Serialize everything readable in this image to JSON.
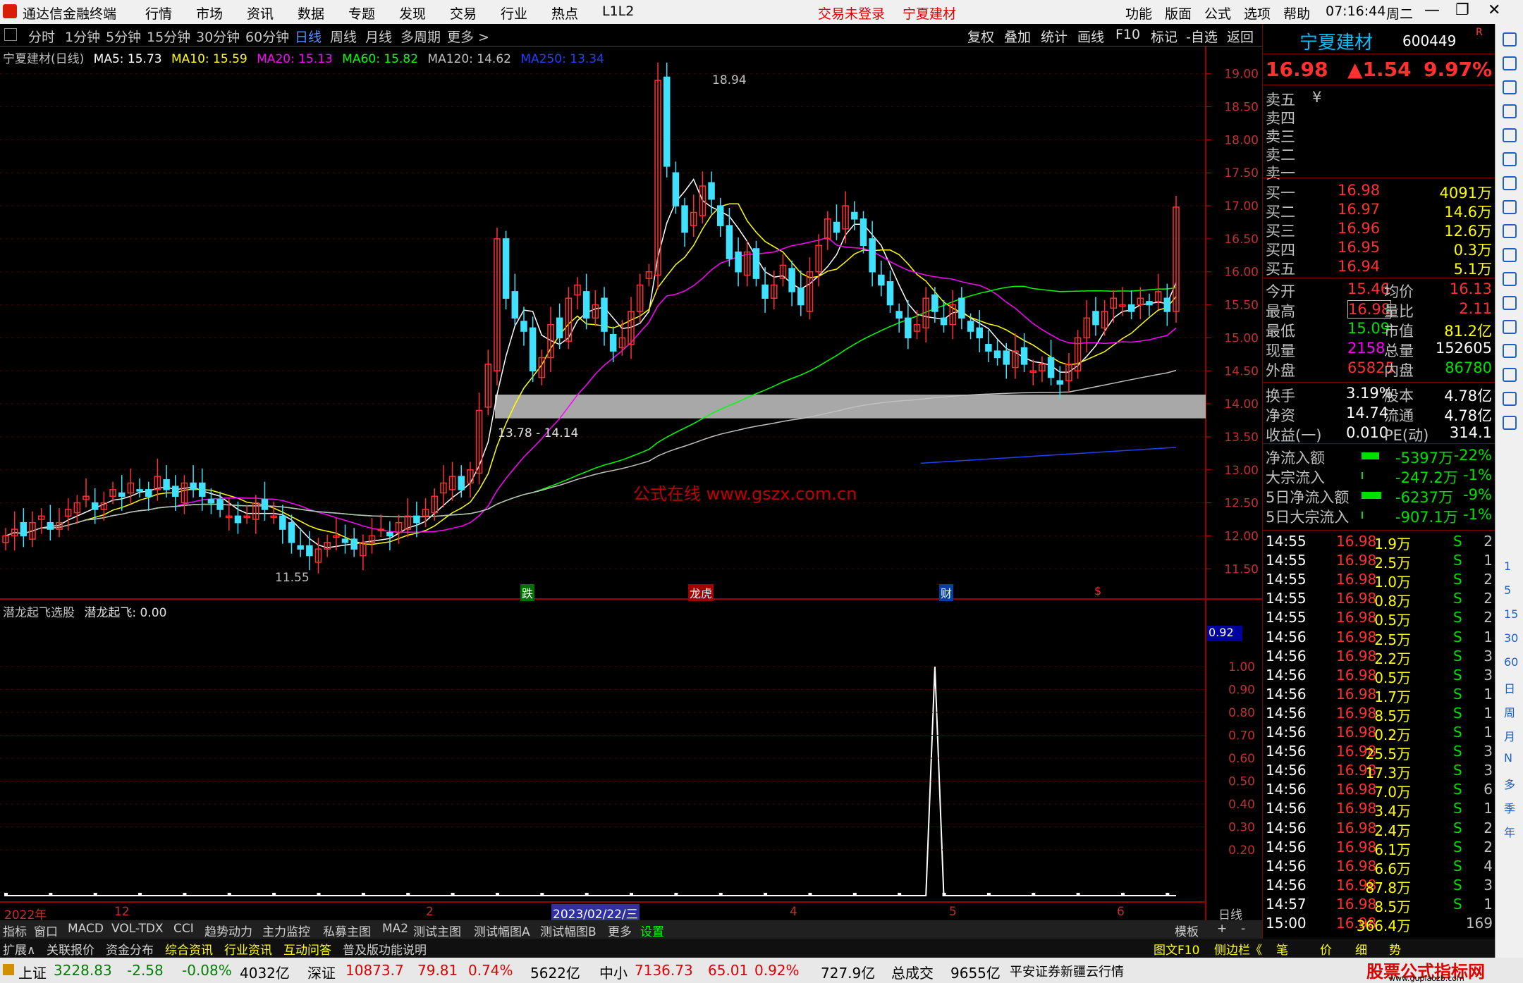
{
  "menubar": {
    "app_title": "通达信金融终端",
    "items": [
      "行情",
      "市场",
      "资讯",
      "数据",
      "专题",
      "发现",
      "交易",
      "行业",
      "热点",
      "L1L2"
    ],
    "login_status": "交易未登录",
    "stock_title": "宁夏建材",
    "right_items": [
      "功能",
      "版面",
      "公式",
      "选项",
      "帮助"
    ],
    "time": "07:16:44",
    "weekday": "周二"
  },
  "periodbar": {
    "periods": [
      "分时",
      "1分钟",
      "5分钟",
      "15分钟",
      "30分钟",
      "60分钟",
      "日线",
      "周线",
      "月线",
      "多周期",
      "更多 >"
    ],
    "active": "日线",
    "tools": [
      "复权",
      "叠加",
      "统计",
      "画线",
      "F10",
      "标记",
      "-自选",
      "返回"
    ]
  },
  "main_legend": {
    "title": "宁夏建材(日线)",
    "mas": [
      {
        "text": "MA5: 15.73",
        "color": "#ffffff"
      },
      {
        "text": "MA10: 15.59",
        "color": "#ffff00"
      },
      {
        "text": "MA20: 15.13",
        "color": "#ff00ff"
      },
      {
        "text": "MA60: 15.82",
        "color": "#00ff00"
      },
      {
        "text": "MA120: 14.62",
        "color": "#c0c0c0"
      },
      {
        "text": "MA250: 13.34",
        "color": "#2040ff"
      }
    ]
  },
  "price_axis": [
    "19.00",
    "18.50",
    "18.00",
    "17.50",
    "17.00",
    "16.50",
    "16.00",
    "15.50",
    "15.00",
    "14.50",
    "14.00",
    "13.50",
    "13.00",
    "12.50",
    "12.00",
    "11.50"
  ],
  "annotations": {
    "high_label": "18.94",
    "low_label": "11.55",
    "band_label": "13.78 - 14.14",
    "watermark": "公式在线  www.gszx.com.cn",
    "event_markers": [
      "跌",
      "龙虎",
      "财",
      "$"
    ]
  },
  "sub_legend": {
    "title": "潜龙起飞选股",
    "value_text": "潜龙起飞: 0.00"
  },
  "sub_axis": [
    "1.00",
    "0.90",
    "0.80",
    "0.70",
    "0.60",
    "0.50",
    "0.40",
    "0.30",
    "0.20"
  ],
  "sub_value_box": "0.92",
  "date_axis": {
    "labels": [
      "2022年",
      "12",
      "2",
      "2023/02/22/三",
      "4",
      "5",
      "6"
    ],
    "period_label": "日线"
  },
  "quote": {
    "name": "宁夏建材",
    "code": "600449",
    "price": "16.98",
    "change": "▲1.54",
    "pct": "9.97%",
    "asks": [
      {
        "label": "卖五",
        "price": "¥",
        "vol": ""
      },
      {
        "label": "卖四",
        "price": "",
        "vol": ""
      },
      {
        "label": "卖三",
        "price": "",
        "vol": ""
      },
      {
        "label": "卖二",
        "price": "",
        "vol": ""
      },
      {
        "label": "卖一",
        "price": "",
        "vol": ""
      }
    ],
    "bids": [
      {
        "label": "买一",
        "price": "16.98",
        "vol": "4091万"
      },
      {
        "label": "买二",
        "price": "16.97",
        "vol": "14.6万"
      },
      {
        "label": "买三",
        "price": "16.96",
        "vol": "12.6万"
      },
      {
        "label": "买四",
        "price": "16.95",
        "vol": "0.3万"
      },
      {
        "label": "买五",
        "price": "16.94",
        "vol": "5.1万"
      }
    ],
    "stats1": [
      {
        "l1": "今开",
        "v1": "15.46",
        "l2": "均价",
        "v2": "16.13"
      },
      {
        "l1": "最高",
        "v1": "16.98",
        "l2": "量比",
        "v2": "2.11"
      },
      {
        "l1": "最低",
        "v1": "15.09",
        "l2": "市值",
        "v2": "81.2亿"
      },
      {
        "l1": "现量",
        "v1": "2158",
        "l2": "总量",
        "v2": "152605"
      },
      {
        "l1": "外盘",
        "v1": "65825",
        "l2": "内盘",
        "v2": "86780"
      }
    ],
    "stats2": [
      {
        "l1": "换手",
        "v1": "3.19%",
        "l2": "股本",
        "v2": "4.78亿"
      },
      {
        "l1": "净资",
        "v1": "14.74",
        "l2": "流通",
        "v2": "4.78亿"
      },
      {
        "l1": "收益(一)",
        "v1": "0.010",
        "l2": "PE(动)",
        "v2": "314.1"
      }
    ],
    "flows": [
      {
        "label": "净流入额",
        "value": "-5397万",
        "pct": "-22%",
        "bar": 0.9
      },
      {
        "label": "大宗流入",
        "value": "-247.2万",
        "pct": "-1%",
        "bar": 0.05
      },
      {
        "label": "5日净流入额",
        "value": "-6237万",
        "pct": "-9%",
        "bar": 1.0
      },
      {
        "label": "5日大宗流入",
        "value": "-907.1万",
        "pct": "-1%",
        "bar": 0.05
      }
    ],
    "ticks": [
      {
        "t": "14:55",
        "p": "16.98",
        "v": "1.9万",
        "s": "S",
        "n": "2"
      },
      {
        "t": "14:55",
        "p": "16.98",
        "v": "2.5万",
        "s": "S",
        "n": "1"
      },
      {
        "t": "14:55",
        "p": "16.98",
        "v": "1.0万",
        "s": "S",
        "n": "2"
      },
      {
        "t": "14:55",
        "p": "16.98",
        "v": "0.8万",
        "s": "S",
        "n": "2"
      },
      {
        "t": "14:55",
        "p": "16.98",
        "v": "0.5万",
        "s": "S",
        "n": "2"
      },
      {
        "t": "14:56",
        "p": "16.98",
        "v": "2.5万",
        "s": "S",
        "n": "1"
      },
      {
        "t": "14:56",
        "p": "16.98",
        "v": "2.2万",
        "s": "S",
        "n": "3"
      },
      {
        "t": "14:56",
        "p": "16.98",
        "v": "0.5万",
        "s": "S",
        "n": "3"
      },
      {
        "t": "14:56",
        "p": "16.98",
        "v": "1.7万",
        "s": "S",
        "n": "1"
      },
      {
        "t": "14:56",
        "p": "16.98",
        "v": "8.5万",
        "s": "S",
        "n": "1"
      },
      {
        "t": "14:56",
        "p": "16.98",
        "v": "0.2万",
        "s": "S",
        "n": "1"
      },
      {
        "t": "14:56",
        "p": "16.98",
        "v": "25.5万",
        "s": "S",
        "n": "3"
      },
      {
        "t": "14:56",
        "p": "16.98",
        "v": "17.3万",
        "s": "S",
        "n": "3"
      },
      {
        "t": "14:56",
        "p": "16.98",
        "v": "7.0万",
        "s": "S",
        "n": "6"
      },
      {
        "t": "14:56",
        "p": "16.98",
        "v": "3.4万",
        "s": "S",
        "n": "1"
      },
      {
        "t": "14:56",
        "p": "16.98",
        "v": "2.4万",
        "s": "S",
        "n": "2"
      },
      {
        "t": "14:56",
        "p": "16.98",
        "v": "6.1万",
        "s": "S",
        "n": "2"
      },
      {
        "t": "14:56",
        "p": "16.98",
        "v": "6.6万",
        "s": "S",
        "n": "4"
      },
      {
        "t": "14:56",
        "p": "16.98",
        "v": "87.8万",
        "s": "S",
        "n": "3"
      },
      {
        "t": "14:57",
        "p": "16.98",
        "v": "8.5万",
        "s": "S",
        "n": "1"
      },
      {
        "t": "15:00",
        "p": "16.98",
        "v": "366.4万",
        "s": "",
        "n": "169"
      }
    ]
  },
  "icon_strip": [
    "close-icon",
    "up-icon",
    "down-icon",
    "page-icon",
    "table-icon",
    "chart-icon",
    "candle-icon",
    "list-icon",
    "f10-icon",
    "layout-icon",
    "grid-icon",
    "search-icon",
    "rss-icon",
    "move-icon",
    "pencil-icon",
    "fs-icon",
    "sound-icon"
  ],
  "icon_strip_text": [
    "1",
    "5",
    "15",
    "30",
    "60",
    "日",
    "周",
    "月",
    "N",
    "多",
    "季",
    "年"
  ],
  "tabs1": [
    "指标",
    "窗口",
    "MACD",
    "VOL-TDX",
    "CCI",
    "趋势动力",
    "主力监控",
    "私募主图",
    "MA2",
    "测试主图",
    "测试幅图A",
    "测试幅图B",
    "更多",
    "设置"
  ],
  "tabs1_right": [
    "模板",
    "+",
    "-"
  ],
  "tabs2": [
    "扩展∧",
    "关联报价",
    "资金分布",
    "综合资讯",
    "行业资讯",
    "互动问答",
    "普及版功能说明"
  ],
  "tabs2_right": [
    "图文F10",
    "侧边栏《",
    "笔",
    "价",
    "细",
    "势"
  ],
  "status": {
    "sh_label": "上证",
    "sh_value": "3228.83",
    "sh_chg": "-2.58",
    "sh_pct": "-0.08%",
    "sh_amt": "4032亿",
    "sz_label": "深证",
    "sz_value": "10873.7",
    "sz_chg": "79.81",
    "sz_pct": "0.74%",
    "sz_amt": "5622亿",
    "zx_label": "中小",
    "zx_value": "7136.73",
    "zx_chg": "65.01",
    "zx_pct": "0.92%",
    "zx_amt": "727.9亿",
    "total_label": "总成交",
    "total_value": "9655亿",
    "broker": "平安证券新疆云行情",
    "site_mark": "股票公式指标网",
    "site_url": "www.gupiaozb.com"
  },
  "chart_data": {
    "type": "candlestick",
    "prices": [
      12.0,
      12.1,
      12.0,
      12.2,
      12.3,
      12.1,
      12.2,
      12.4,
      12.5,
      12.6,
      12.4,
      12.5,
      12.7,
      12.6,
      12.8,
      12.7,
      12.6,
      12.9,
      12.7,
      12.6,
      12.8,
      12.7,
      12.6,
      12.5,
      12.4,
      12.3,
      12.2,
      12.3,
      12.5,
      12.4,
      12.3,
      12.1,
      11.9,
      11.8,
      11.7,
      11.8,
      11.9,
      12.0,
      11.9,
      11.8,
      11.9,
      12.0,
      12.1,
      12.0,
      12.2,
      12.3,
      12.2,
      12.4,
      12.6,
      12.8,
      12.9,
      12.7,
      13.0,
      13.9,
      14.6,
      16.5,
      15.6,
      15.3,
      15.1,
      14.5,
      14.7,
      15.2,
      15.0,
      15.6,
      15.8,
      15.3,
      15.5,
      15.1,
      14.8,
      15.0,
      15.4,
      15.8,
      16.0,
      18.9,
      17.6,
      17.0,
      16.6,
      16.9,
      17.3,
      17.1,
      16.7,
      16.2,
      16.0,
      16.3,
      15.9,
      15.6,
      15.8,
      16.1,
      15.7,
      15.5,
      16.0,
      16.4,
      16.8,
      16.6,
      17.0,
      16.8,
      16.4,
      16.0,
      15.8,
      15.5,
      15.3,
      15.0,
      15.2,
      15.6,
      15.4,
      15.2,
      15.5,
      15.3,
      15.1,
      15.0,
      14.8,
      14.7,
      14.6,
      14.8,
      14.6,
      14.5,
      14.6,
      14.4,
      14.3,
      14.6,
      15.0,
      15.3,
      15.2,
      15.4,
      15.6,
      15.5,
      15.4,
      15.6,
      15.5,
      15.7,
      15.4,
      16.98
    ],
    "ylim": [
      11.3,
      19.2
    ],
    "band": [
      13.78,
      14.14
    ],
    "high": 18.94,
    "low": 11.55,
    "signal_index": 104,
    "signal_value": 1.0
  }
}
